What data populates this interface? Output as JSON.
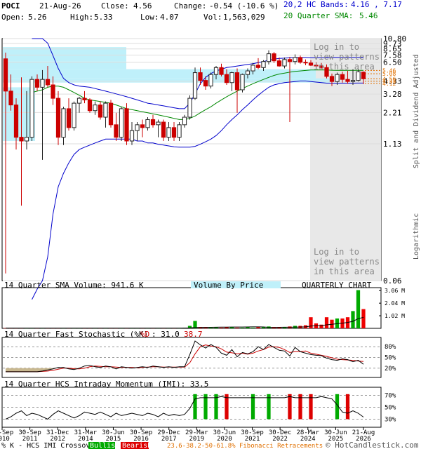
{
  "header": {
    "symbol": "POCI",
    "date": "21-Aug-26",
    "close_label": "Close:",
    "close": "4.56",
    "change_label": "Change:",
    "change": "-0.54 (-10.6 %)",
    "open_label": "Open:",
    "open": "5.26",
    "high_label": "High:",
    "high": "5.33",
    "low_label": "Low:",
    "low": "4.07",
    "vol_label": "Vol:",
    "vol": "1,563,029",
    "bands_label": "20,2 HC Bands:",
    "bands": "4.16 , 7.17",
    "sma_label": "20 Quarter SMA:",
    "sma": "5.46"
  },
  "notes": {
    "login_top": [
      "Log in to",
      "view patterns",
      "in this area"
    ],
    "login_bottom": [
      "Log in to",
      "view patterns",
      "in this area"
    ],
    "split_adjusted": "Split and Dividend Adjusted",
    "logarithmic": "Logarithmic"
  },
  "volume_panel": {
    "title": "14 Quarter SMA Volume: 941.6 K",
    "vbp": "Volume By Price",
    "chart_type": "QUARTERLY CHART"
  },
  "stoch_panel": {
    "title_a": "14 Quarter Fast Stochastic (%K)",
    "title_d": "%D",
    "title_vals": ": 31.0",
    "title_d_val": "38.7"
  },
  "momentum_panel": {
    "title": "14 Quarter HCS Intraday Momentum (IMI): 33.5"
  },
  "footer": {
    "crossover": "% K - HCS IMI Crossover:",
    "bullish": "Bullish",
    "bearish": "Bearish",
    "fib": "23.6-38.2-50-61.8% Fibonacci Retracements",
    "copyright": "© HotCandlestick.com"
  },
  "colors": {
    "up": "#222222",
    "down": "#cc0000",
    "bb": "#0000cc",
    "sma": "#008800",
    "vbp": "#bff0fa",
    "bullish": "#00aa00",
    "bearish": "#dd0000",
    "shade": "#e8e8e8"
  },
  "chart_data": [
    {
      "type": "candlestick",
      "scale": "log",
      "price_ticks": [
        "10.80",
        "9.73",
        "8.65",
        "7.58",
        "6.50",
        "4.33",
        "3.28",
        "2.21",
        "1.13",
        "0.06"
      ],
      "right_labels": [
        "5.46",
        "5.08",
        "4.56",
        "4.33",
        "4.12"
      ],
      "x_ticks": [
        [
          "30-Sep",
          "2010"
        ],
        [
          "30-Sep",
          "2011"
        ],
        [
          "31-Dec",
          "2012"
        ],
        [
          "31-Mar",
          "2014"
        ],
        [
          "30-Jun",
          "2015"
        ],
        [
          "30-Sep",
          "2016"
        ],
        [
          "29-Dec",
          "2017"
        ],
        [
          "29-Mar",
          "2019"
        ],
        [
          "30-Jun",
          "2020"
        ],
        [
          "30-Sep",
          "2021"
        ],
        [
          "30-Dec",
          "2022"
        ],
        [
          "28-Mar",
          "2024"
        ],
        [
          "30-Jun",
          "2025"
        ],
        [
          "21-Aug",
          "2026"
        ]
      ],
      "candles": [
        {
          "o": 7.0,
          "h": 8.0,
          "l": 0.07,
          "c": 3.5
        },
        {
          "o": 3.5,
          "h": 5.0,
          "l": 2.3,
          "c": 2.6
        },
        {
          "o": 2.6,
          "h": 3.0,
          "l": 1.0,
          "c": 1.3
        },
        {
          "o": 1.3,
          "h": 4.7,
          "l": 0.3,
          "c": 1.2
        },
        {
          "o": 1.2,
          "h": 3.5,
          "l": 1.0,
          "c": 1.3
        },
        {
          "o": 1.3,
          "h": 4.8,
          "l": 1.2,
          "c": 4.5
        },
        {
          "o": 4.5,
          "h": 5.0,
          "l": 3.5,
          "c": 3.8
        },
        {
          "o": 3.8,
          "h": 5.5,
          "l": 0.8,
          "c": 4.5
        },
        {
          "o": 4.5,
          "h": 6.0,
          "l": 3.8,
          "c": 4.0
        },
        {
          "o": 4.0,
          "h": 4.8,
          "l": 2.6,
          "c": 3.0
        },
        {
          "o": 3.0,
          "h": 3.5,
          "l": 1.1,
          "c": 1.3
        },
        {
          "o": 1.3,
          "h": 2.5,
          "l": 1.1,
          "c": 2.4
        },
        {
          "o": 2.4,
          "h": 3.0,
          "l": 1.5,
          "c": 1.6
        },
        {
          "o": 1.6,
          "h": 2.8,
          "l": 1.5,
          "c": 2.7
        },
        {
          "o": 2.7,
          "h": 3.1,
          "l": 2.2,
          "c": 3.0
        },
        {
          "o": 3.0,
          "h": 3.5,
          "l": 2.7,
          "c": 2.9
        },
        {
          "o": 2.9,
          "h": 3.0,
          "l": 2.2,
          "c": 2.3
        },
        {
          "o": 2.3,
          "h": 2.8,
          "l": 2.1,
          "c": 2.6
        },
        {
          "o": 2.6,
          "h": 2.8,
          "l": 1.9,
          "c": 2.0
        },
        {
          "o": 2.0,
          "h": 2.8,
          "l": 1.6,
          "c": 2.7
        },
        {
          "o": 2.7,
          "h": 2.9,
          "l": 1.6,
          "c": 1.7
        },
        {
          "o": 1.7,
          "h": 2.2,
          "l": 1.2,
          "c": 1.3
        },
        {
          "o": 1.3,
          "h": 2.5,
          "l": 1.2,
          "c": 2.4
        },
        {
          "o": 2.4,
          "h": 2.7,
          "l": 1.1,
          "c": 1.2
        },
        {
          "o": 1.2,
          "h": 1.8,
          "l": 1.1,
          "c": 1.5
        },
        {
          "o": 1.5,
          "h": 1.8,
          "l": 1.2,
          "c": 1.7
        },
        {
          "o": 1.7,
          "h": 1.9,
          "l": 1.3,
          "c": 1.6
        },
        {
          "o": 1.6,
          "h": 2.0,
          "l": 1.5,
          "c": 1.9
        },
        {
          "o": 1.9,
          "h": 2.1,
          "l": 1.6,
          "c": 1.7
        },
        {
          "o": 1.7,
          "h": 1.9,
          "l": 1.3,
          "c": 1.8
        },
        {
          "o": 1.8,
          "h": 1.9,
          "l": 1.2,
          "c": 1.3
        },
        {
          "o": 1.3,
          "h": 1.8,
          "l": 1.2,
          "c": 1.6
        },
        {
          "o": 1.6,
          "h": 1.8,
          "l": 1.2,
          "c": 1.3
        },
        {
          "o": 1.3,
          "h": 1.8,
          "l": 1.2,
          "c": 1.7
        },
        {
          "o": 1.7,
          "h": 2.1,
          "l": 1.6,
          "c": 2.0
        },
        {
          "o": 2.0,
          "h": 3.2,
          "l": 1.9,
          "c": 3.0
        },
        {
          "o": 3.0,
          "h": 5.8,
          "l": 2.9,
          "c": 5.2
        },
        {
          "o": 5.2,
          "h": 5.8,
          "l": 4.0,
          "c": 4.4
        },
        {
          "o": 4.4,
          "h": 4.8,
          "l": 3.6,
          "c": 3.9
        },
        {
          "o": 3.9,
          "h": 5.2,
          "l": 3.7,
          "c": 5.0
        },
        {
          "o": 5.0,
          "h": 6.0,
          "l": 4.5,
          "c": 5.8
        },
        {
          "o": 5.8,
          "h": 6.3,
          "l": 4.8,
          "c": 5.0
        },
        {
          "o": 5.0,
          "h": 5.6,
          "l": 4.0,
          "c": 4.2
        },
        {
          "o": 4.2,
          "h": 5.3,
          "l": 3.5,
          "c": 5.2
        },
        {
          "o": 5.2,
          "h": 5.7,
          "l": 2.2,
          "c": 3.6
        },
        {
          "o": 3.6,
          "h": 5.1,
          "l": 3.4,
          "c": 5.0
        },
        {
          "o": 5.0,
          "h": 5.7,
          "l": 4.6,
          "c": 5.4
        },
        {
          "o": 5.4,
          "h": 6.4,
          "l": 5.0,
          "c": 6.1
        },
        {
          "o": 6.1,
          "h": 7.1,
          "l": 5.6,
          "c": 5.8
        },
        {
          "o": 5.8,
          "h": 6.8,
          "l": 5.4,
          "c": 6.6
        },
        {
          "o": 6.6,
          "h": 8.4,
          "l": 6.2,
          "c": 7.8
        },
        {
          "o": 7.8,
          "h": 8.1,
          "l": 6.4,
          "c": 6.7
        },
        {
          "o": 6.7,
          "h": 7.2,
          "l": 5.9,
          "c": 6.0
        },
        {
          "o": 6.0,
          "h": 7.2,
          "l": 5.7,
          "c": 6.9
        },
        {
          "o": 6.9,
          "h": 7.3,
          "l": 1.8,
          "c": 6.6
        },
        {
          "o": 6.6,
          "h": 7.7,
          "l": 6.2,
          "c": 7.2
        },
        {
          "o": 7.2,
          "h": 7.5,
          "l": 6.3,
          "c": 6.5
        },
        {
          "o": 6.5,
          "h": 6.9,
          "l": 6.1,
          "c": 6.4
        },
        {
          "o": 6.4,
          "h": 6.8,
          "l": 6.0,
          "c": 6.1
        },
        {
          "o": 6.1,
          "h": 6.5,
          "l": 5.7,
          "c": 6.0
        },
        {
          "o": 6.0,
          "h": 6.4,
          "l": 5.6,
          "c": 5.8
        },
        {
          "o": 5.8,
          "h": 6.2,
          "l": 4.6,
          "c": 4.8
        },
        {
          "o": 4.8,
          "h": 5.1,
          "l": 3.9,
          "c": 4.3
        },
        {
          "o": 4.3,
          "h": 5.2,
          "l": 4.0,
          "c": 5.0
        },
        {
          "o": 5.0,
          "h": 5.3,
          "l": 4.2,
          "c": 4.5
        },
        {
          "o": 4.5,
          "h": 5.4,
          "l": 4.1,
          "c": 4.3
        },
        {
          "o": 4.3,
          "h": 5.6,
          "l": 4.0,
          "c": 4.4
        },
        {
          "o": 4.4,
          "h": 5.6,
          "l": 4.3,
          "c": 5.3
        },
        {
          "o": 5.26,
          "h": 5.33,
          "l": 4.07,
          "c": 4.56
        }
      ],
      "bb_upper": [
        null,
        null,
        null,
        null,
        null,
        10.8,
        10.8,
        10.8,
        9.8,
        7.5,
        5.7,
        4.6,
        4.2,
        4.0,
        3.9,
        3.85,
        3.8,
        3.7,
        3.6,
        3.5,
        3.4,
        3.3,
        3.2,
        3.1,
        3.0,
        2.9,
        2.8,
        2.7,
        2.65,
        2.6,
        2.55,
        2.5,
        2.45,
        2.4,
        2.4,
        2.7,
        3.3,
        4.1,
        4.7,
        5.1,
        5.4,
        5.6,
        5.8,
        5.9,
        6.0,
        6.1,
        6.2,
        6.3,
        6.45,
        6.6,
        6.8,
        6.95,
        7.05,
        7.1,
        7.15,
        7.2,
        7.2,
        7.2,
        7.15,
        7.15,
        7.15,
        7.15,
        7.2,
        7.2,
        7.2,
        7.2,
        7.2,
        7.2,
        7.17
      ],
      "bb_lower": [
        null,
        null,
        null,
        null,
        null,
        0.04,
        0.05,
        0.06,
        0.1,
        0.25,
        0.45,
        0.6,
        0.75,
        0.9,
        1.0,
        1.05,
        1.1,
        1.15,
        1.2,
        1.25,
        1.25,
        1.25,
        1.25,
        1.25,
        1.25,
        1.2,
        1.2,
        1.15,
        1.15,
        1.12,
        1.1,
        1.08,
        1.06,
        1.05,
        1.05,
        1.05,
        1.07,
        1.12,
        1.18,
        1.25,
        1.35,
        1.5,
        1.7,
        1.9,
        2.1,
        2.35,
        2.6,
        2.9,
        3.2,
        3.5,
        3.8,
        4.0,
        4.1,
        4.2,
        4.25,
        4.3,
        4.35,
        4.35,
        4.3,
        4.25,
        4.2,
        4.15,
        4.15,
        4.15,
        4.15,
        4.15,
        4.15,
        4.16,
        4.16
      ],
      "sma": [
        null,
        null,
        null,
        null,
        null,
        3.4,
        3.5,
        3.6,
        3.8,
        3.9,
        3.9,
        3.8,
        3.6,
        3.4,
        3.2,
        3.0,
        2.9,
        2.85,
        2.8,
        2.75,
        2.7,
        2.6,
        2.5,
        2.4,
        2.35,
        2.3,
        2.25,
        2.2,
        2.15,
        2.1,
        2.05,
        2.0,
        1.95,
        1.9,
        1.9,
        1.95,
        2.05,
        2.2,
        2.35,
        2.5,
        2.7,
        2.9,
        3.1,
        3.3,
        3.5,
        3.7,
        3.9,
        4.1,
        4.3,
        4.5,
        4.7,
        4.9,
        5.05,
        5.15,
        5.25,
        5.35,
        5.4,
        5.45,
        5.5,
        5.5,
        5.5,
        5.5,
        5.48,
        5.47,
        5.46,
        5.46,
        5.46,
        5.46,
        5.46
      ],
      "volume_ticks": [
        "3.06 M",
        "2.04 M",
        "1.02 M"
      ],
      "volume": [
        0.02,
        0.02,
        0.02,
        0.02,
        0.02,
        0.02,
        0.02,
        0.02,
        0.02,
        0.02,
        0.02,
        0.02,
        0.02,
        0.02,
        0.02,
        0.02,
        0.02,
        0.02,
        0.02,
        0.02,
        0.02,
        0.02,
        0.02,
        0.02,
        0.02,
        0.02,
        0.02,
        0.02,
        0.02,
        0.02,
        0.02,
        0.02,
        0.02,
        0.02,
        0.05,
        0.2,
        0.6,
        0.1,
        0.05,
        0.05,
        0.1,
        0.05,
        0.1,
        0.1,
        0.05,
        0.05,
        0.1,
        0.05,
        0.1,
        0.1,
        0.15,
        0.1,
        0.1,
        0.1,
        0.15,
        0.2,
        0.2,
        0.25,
        0.9,
        0.4,
        0.3,
        0.9,
        0.7,
        0.8,
        0.8,
        0.9,
        1.4,
        3.1,
        1.56
      ],
      "stoch_ticks": [
        "80%",
        "50%",
        "20%"
      ],
      "stoch_k": [
        10,
        10,
        10,
        10,
        10,
        10,
        10,
        12,
        15,
        18,
        22,
        22,
        18,
        16,
        20,
        26,
        28,
        24,
        22,
        26,
        24,
        18,
        24,
        22,
        20,
        22,
        24,
        22,
        26,
        24,
        22,
        24,
        22,
        24,
        24,
        58,
        96,
        85,
        76,
        86,
        78,
        62,
        56,
        72,
        52,
        64,
        60,
        66,
        80,
        72,
        86,
        78,
        70,
        68,
        54,
        78,
        66,
        62,
        58,
        56,
        55,
        48,
        44,
        42,
        46,
        44,
        38,
        42,
        31
      ],
      "stoch_d": [
        10,
        10,
        10,
        10,
        10,
        10,
        10,
        11,
        12,
        14,
        17,
        20,
        20,
        18,
        18,
        20,
        24,
        26,
        25,
        24,
        24,
        23,
        22,
        22,
        22,
        21,
        22,
        23,
        24,
        24,
        23,
        23,
        23,
        23,
        23,
        35,
        60,
        80,
        85,
        82,
        80,
        74,
        65,
        63,
        60,
        62,
        59,
        62,
        68,
        72,
        79,
        80,
        78,
        72,
        64,
        66,
        66,
        68,
        62,
        59,
        56,
        53,
        49,
        45,
        44,
        43,
        42,
        40,
        38.7
      ],
      "imi_ticks": [
        "70%",
        "50%",
        "30%"
      ],
      "imi": [
        30,
        34,
        40,
        44,
        36,
        40,
        38,
        34,
        30,
        38,
        44,
        40,
        36,
        32,
        36,
        42,
        40,
        38,
        42,
        38,
        34,
        40,
        36,
        38,
        40,
        38,
        36,
        40,
        38,
        34,
        40,
        36,
        38,
        36,
        38,
        48,
        64,
        66,
        66,
        66,
        66,
        68,
        66,
        66,
        66,
        66,
        66,
        66,
        66,
        66,
        66,
        66,
        66,
        66,
        68,
        66,
        66,
        66,
        66,
        66,
        68,
        66,
        64,
        54,
        42,
        40,
        44,
        40,
        33.5
      ],
      "crossovers": [
        {
          "i": 36,
          "t": "bull"
        },
        {
          "i": 38,
          "t": "bull"
        },
        {
          "i": 40,
          "t": "bull"
        },
        {
          "i": 42,
          "t": "bear"
        },
        {
          "i": 47,
          "t": "bull"
        },
        {
          "i": 50,
          "t": "bull"
        },
        {
          "i": 54,
          "t": "bear"
        },
        {
          "i": 56,
          "t": "bear"
        },
        {
          "i": 58,
          "t": "bear"
        },
        {
          "i": 63,
          "t": "bull"
        },
        {
          "i": 65,
          "t": "bear"
        }
      ]
    }
  ]
}
